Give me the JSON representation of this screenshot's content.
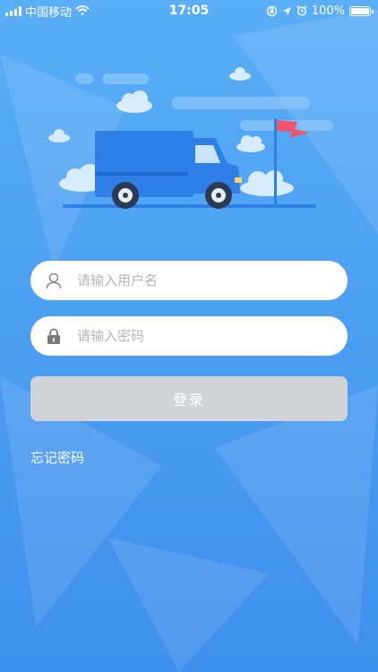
{
  "status_bar": {
    "carrier": "中国移动",
    "time": "17:05",
    "battery_percent": "100%",
    "battery_level": 1.0,
    "icons": [
      "signal-icon",
      "wifi-icon",
      "rotation-lock-icon",
      "location-icon",
      "alarm-icon",
      "battery-icon"
    ]
  },
  "login": {
    "username_placeholder": "请输入用户名",
    "password_placeholder": "请输入密码",
    "submit_label": "登录",
    "forgot_password_label": "忘记密码",
    "icons": {
      "username": "user-icon",
      "password": "lock-icon"
    }
  },
  "colors": {
    "background_top": "#5aaef6",
    "background_bottom": "#3f8fee",
    "truck": "#2f7fe6",
    "flag": "#f0546a",
    "button_disabled": "#d0d4d9"
  }
}
